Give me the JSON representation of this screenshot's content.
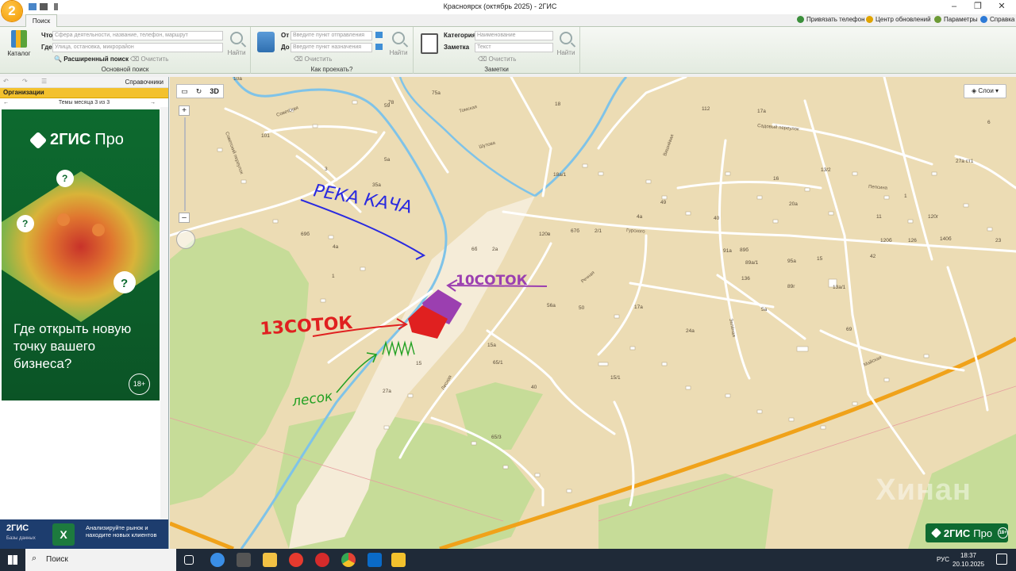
{
  "window": {
    "title": "Красноярск (октябрь 2025) - 2ГИС",
    "logo_text": "2"
  },
  "toplinks": {
    "phone": "Привязать телефон",
    "updates": "Центр обновлений",
    "params": "Параметры",
    "help": "Справка"
  },
  "ribbon": {
    "tab_label": "Поиск",
    "catalog_label": "Каталог",
    "what_label": "Что",
    "what_placeholder": "Сфера деятельности, название, телефон, маршрут",
    "where_label": "Где",
    "where_placeholder": "Улица, остановка, микрорайон",
    "find_label": "Найти",
    "extended_search": "Расширенный поиск",
    "clear_label": "Очистить",
    "group_search": "Основной поиск",
    "from_label": "От",
    "from_placeholder": "Введите пункт отправления",
    "to_label": "До",
    "to_placeholder": "Введите пункт назначения",
    "group_route": "Как проехать?",
    "category_label": "Категория",
    "category_value": "Наименование",
    "note_label": "Заметка",
    "note_placeholder": "Текст",
    "group_notes": "Заметки"
  },
  "left_panel": {
    "directories_label": "Справочники",
    "tab_label": "Организации",
    "themes_label": "Темы месяца 3 из 3",
    "ad_brand": "2ГИС",
    "ad_brand_suffix": "Про",
    "ad_text": "Где открыть новую точку вашего бизнеса?",
    "ad_age": "18+",
    "bottom_ad_brand": "2ГИС",
    "bottom_ad_sub": "Базы данных",
    "bottom_ad_msg": "Анализируйте рынок и находите новых клиентов",
    "bottom_ad_icon": "X"
  },
  "map": {
    "tool_3d": "3D",
    "layers_label": "Слои",
    "pro_badge_brand": "2ГИС",
    "pro_badge_suffix": "Про",
    "pro_badge_age": "18+",
    "watermark": "Хинан",
    "street_labels": {
      "sovetskaya": "Советская",
      "tomskaya": "Томская",
      "shutova": "Шутова",
      "gurskogo": "Гурского",
      "rechnaya": "Речная",
      "lesnaya": "Лесная",
      "zelenaya": "Зелёная",
      "mayskaya": "Майская",
      "pepsina": "Пепсина",
      "sadovy": "Садовый переулок",
      "sovetsky": "Советский переулок",
      "vishnevaya": "Вишнёвая"
    },
    "house_numbers": [
      "10а",
      "75а",
      "18",
      "112",
      "17а",
      "78",
      "59",
      "101",
      "5а",
      "13/2",
      "6",
      "27а ст1",
      "18а/1",
      "16",
      "1",
      "3",
      "35а",
      "49",
      "40",
      "4а",
      "20а",
      "120г",
      "11",
      "69б",
      "67б",
      "2/1",
      "120в",
      "120б",
      "126",
      "140б",
      "23",
      "4а",
      "6б",
      "2а",
      "91а",
      "89б",
      "95а",
      "89а/1",
      "42",
      "15",
      "1",
      "136",
      "89г",
      "13а/1",
      "5а",
      "56а",
      "50",
      "17а",
      "69",
      "24а",
      "15",
      "15а",
      "65/1",
      "15/1",
      "40",
      "27а",
      "65/3"
    ],
    "annotations": {
      "river": "РЕКА КАЧА",
      "plot_purple": "10СОТОК",
      "plot_red": "13СОТОК",
      "forest": "лесок"
    }
  },
  "taskbar": {
    "search_label": "Поиск",
    "language": "РУС",
    "time": "18:37",
    "date": "20.10.2025"
  },
  "colors": {
    "ribbon_bg": "#e3ebe0",
    "accent_orange": "#f39a00",
    "tab_yellow": "#f3c12d",
    "map_land": "#ecdcb4",
    "map_green": "#c6dc98",
    "river": "#7fc3e8",
    "annotation_blue": "#2a2ae0",
    "annotation_purple": "#9b3fb0",
    "annotation_red": "#e02020",
    "annotation_green": "#22a022"
  }
}
